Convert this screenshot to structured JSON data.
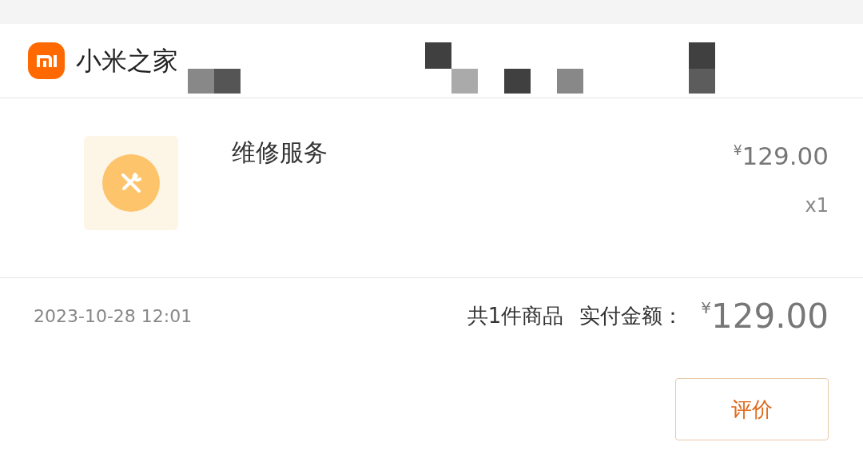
{
  "store": {
    "name": "小米之家"
  },
  "item": {
    "name": "维修服务",
    "currency": "¥",
    "price": "129.00",
    "quantity": "x1"
  },
  "summary": {
    "date": "2023-10-28 12:01",
    "count": "共1件商品",
    "total_label": "实付金额：",
    "currency": "¥",
    "total": "129.00"
  },
  "buttons": [
    {
      "label": "评价"
    }
  ]
}
